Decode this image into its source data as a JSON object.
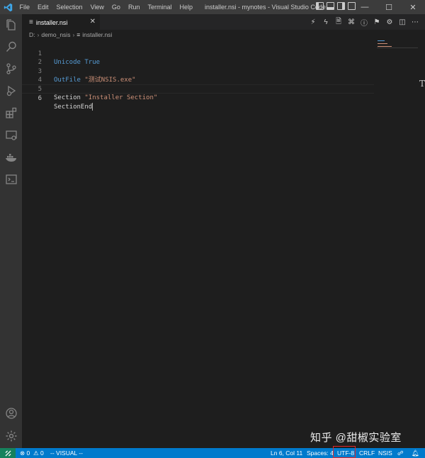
{
  "menu": [
    "File",
    "Edit",
    "Selection",
    "View",
    "Go",
    "Run",
    "Terminal",
    "Help"
  ],
  "window_title": "installer.nsi - mynotes - Visual Studio Code",
  "window_controls": {
    "minimize": "—",
    "maximize": "☐",
    "close": "✕"
  },
  "tab": {
    "label": "installer.nsi",
    "close": "✕"
  },
  "breadcrumb": {
    "drive": "D:",
    "folder": "demo_nsis",
    "file": "installer.nsi"
  },
  "editor": {
    "line_numbers": [
      "1",
      "2",
      "3",
      "4",
      "5",
      "6"
    ],
    "line1": {
      "kw": "Unicode",
      "val": "True"
    },
    "line3": {
      "kw": "OutFile",
      "str": "\"测试NSIS.exe\""
    },
    "line5": {
      "kw": "Section",
      "str": "\"Installer Section\""
    },
    "line6": {
      "kw": "SectionEnd"
    }
  },
  "scroll_marker": "T",
  "watermark": "知乎 @甜椒实验室",
  "statusbar": {
    "errors": "0",
    "warnings": "0",
    "mode": "-- VISUAL --",
    "position": "Ln 6, Col 11",
    "spaces": "Spaces: 4",
    "encoding": "UTF-8",
    "eol": "CRLF",
    "language": "NSIS"
  },
  "colors": {
    "statusbar": "#007acc",
    "remote": "#16825d",
    "keyword": "#569cd6",
    "string": "#ce9178",
    "highlight_box": "#e0272b"
  }
}
